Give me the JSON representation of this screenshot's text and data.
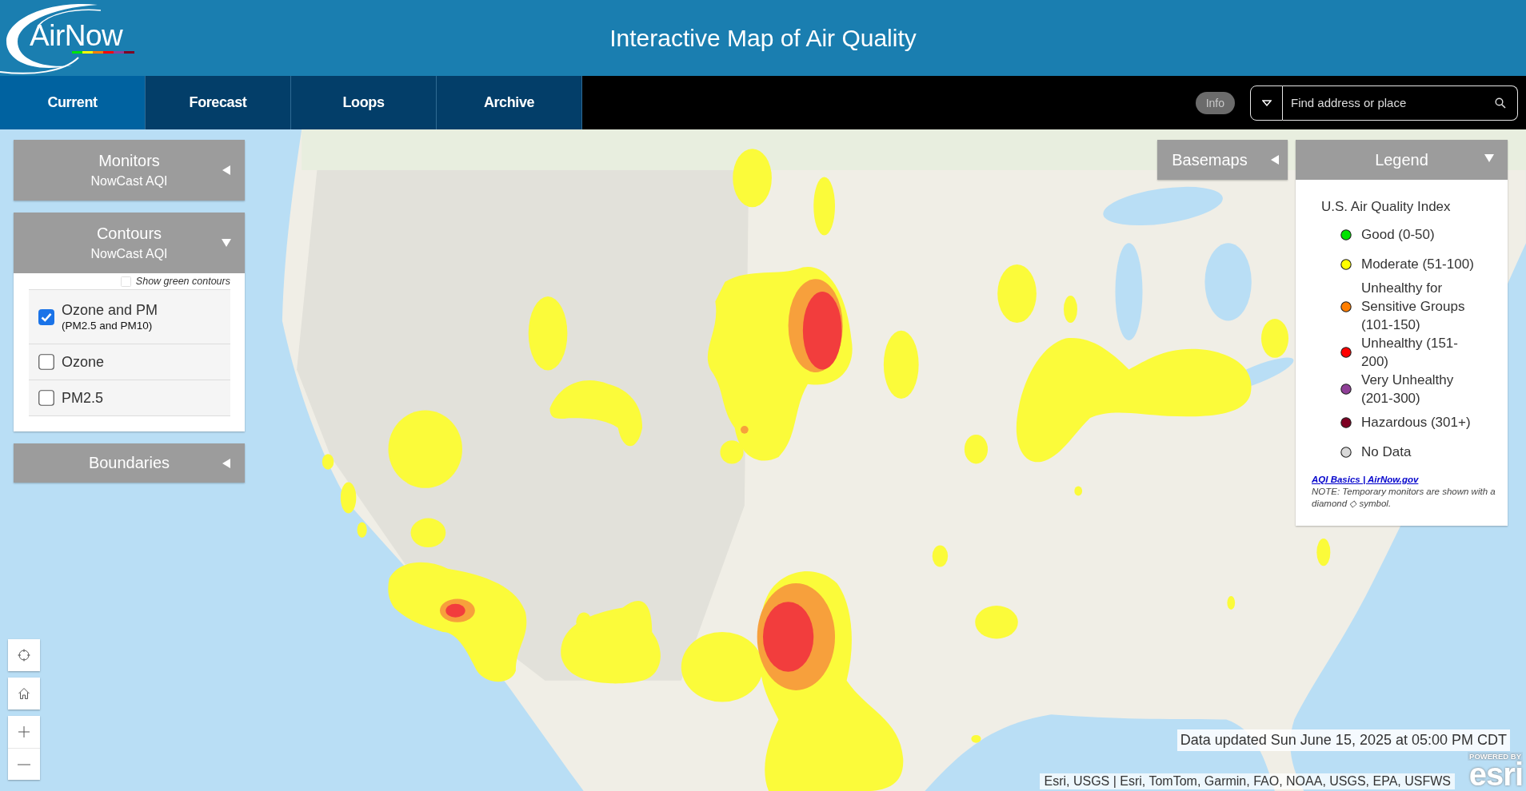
{
  "header": {
    "logo": "AirNow",
    "title": "Interactive Map of Air Quality"
  },
  "tabs": [
    {
      "label": "Current",
      "selected": true
    },
    {
      "label": "Forecast",
      "selected": false
    },
    {
      "label": "Loops",
      "selected": false
    },
    {
      "label": "Archive",
      "selected": false
    }
  ],
  "toolbar": {
    "info_button": "Info",
    "search": {
      "placeholder": "Find address or place"
    }
  },
  "panels": [
    {
      "title": "Monitors",
      "subtitle": "NowCast AQI",
      "expanded": false
    },
    {
      "title": "Contours",
      "subtitle": "NowCast AQI",
      "expanded": true,
      "green_contours": {
        "label": "Show green contours",
        "checked": false
      },
      "options": [
        {
          "label": "Ozone and PM",
          "sublabel": "(PM2.5 and PM10)",
          "checked": true
        },
        {
          "label": "Ozone",
          "checked": false
        },
        {
          "label": "PM2.5",
          "checked": false
        }
      ]
    },
    {
      "title": "Boundaries",
      "expanded": false
    }
  ],
  "basemaps": {
    "label": "Basemaps",
    "expanded": false
  },
  "legend": {
    "title": "Legend",
    "expanded": true,
    "heading": "U.S. Air Quality Index",
    "items": [
      {
        "label": "Good (0-50)",
        "color": "#00e400"
      },
      {
        "label": "Moderate (51-100)",
        "color": "#ffff00"
      },
      {
        "label": "Unhealthy for Sensitive Groups (101-150)",
        "color": "#ff7e00"
      },
      {
        "label": "Unhealthy (151-200)",
        "color": "#ff0000"
      },
      {
        "label": "Very Unhealthy (201-300)",
        "color": "#8f3f97"
      },
      {
        "label": "Hazardous (301+)",
        "color": "#7e0023"
      },
      {
        "label": "No Data",
        "color": "#d9d9d9"
      }
    ],
    "link": "AQI Basics | AirNow.gov",
    "note": "NOTE: Temporary monitors are shown with a diamond ◇ symbol."
  },
  "map": {
    "data_updated": "Data updated Sun June 15, 2025 at 05:00 PM CDT",
    "attribution": "Esri, USGS | Esri, TomTom, Garmin, FAO, NOAA, USGS, EPA, USFWS",
    "logo_caption": "POWERED BY",
    "logo": "esri"
  }
}
